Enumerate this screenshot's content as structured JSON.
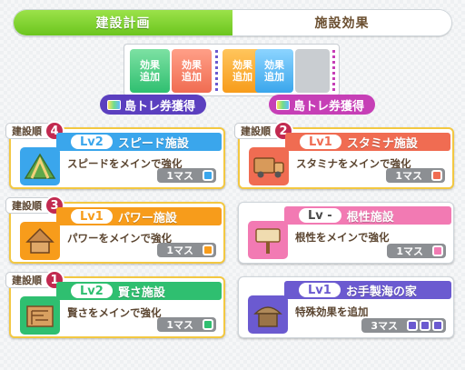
{
  "tabs": [
    {
      "label": "建設計画"
    },
    {
      "label": "施設効果"
    }
  ],
  "plan_slots": [
    {
      "line1": "効果",
      "line2": "追加"
    },
    {
      "line1": "効果",
      "line2": "追加"
    },
    {
      "line1": "効果",
      "line2": "追加"
    },
    {
      "line1": "効果",
      "line2": "追加"
    }
  ],
  "tickets": [
    {
      "label": "島トレ券獲得"
    },
    {
      "label": "島トレ券獲得"
    }
  ],
  "cards": [
    {
      "order_label": "建設順",
      "order_num": "4",
      "level": "Lv2",
      "name": "スピード施設",
      "desc": "スピードをメインで強化",
      "mass": "1マス",
      "color": "#3aa6ec"
    },
    {
      "order_label": "建設順",
      "order_num": "2",
      "level": "Lv1",
      "name": "スタミナ施設",
      "desc": "スタミナをメインで強化",
      "mass": "1マス",
      "color": "#f06c52"
    },
    {
      "order_label": "建設順",
      "order_num": "3",
      "level": "Lv1",
      "name": "パワー施設",
      "desc": "パワーをメインで強化",
      "mass": "1マス",
      "color": "#f79c1b"
    },
    {
      "level": "Lv -",
      "name": "根性施設",
      "desc": "根性をメインで強化",
      "mass": "1マス",
      "color": "#f27ab3"
    },
    {
      "order_label": "建設順",
      "order_num": "1",
      "level": "Lv2",
      "name": "賢さ施設",
      "desc": "賢さをメインで強化",
      "mass": "1マス",
      "color": "#2fbf70"
    },
    {
      "level": "Lv1",
      "name": "お手製海の家",
      "desc": "特殊効果を追加",
      "mass": "3マス",
      "color": "#6b5ad0"
    }
  ],
  "icons": {
    "speed": "mountain-track-icon",
    "stamina": "truck-icon",
    "power": "wood-hut-icon",
    "guts": "signboard-icon",
    "wisdom": "maze-board-icon",
    "beach_house": "beach-house-icon"
  }
}
